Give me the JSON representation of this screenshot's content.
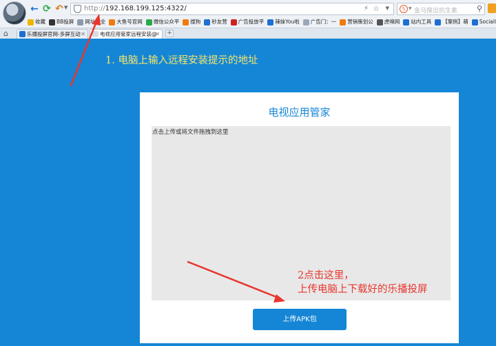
{
  "browser": {
    "address": {
      "url_prefix": "http://",
      "url_host": "192.168.199.125:4322/"
    },
    "search": {
      "placeholder": "金马搜出抗生素"
    },
    "bookmarks": [
      {
        "label": "收藏",
        "color": "#f0b400"
      },
      {
        "label": "BB投屏",
        "color": "#333333"
      },
      {
        "label": "网址大全",
        "color": "#8a9aab"
      },
      {
        "label": "大鱼号官网",
        "color": "#f07a10"
      },
      {
        "label": "微信公众平",
        "color": "#2aa84a"
      },
      {
        "label": "搜狗",
        "color": "#f07a10"
      },
      {
        "label": "秒友营",
        "color": "#1e6fd1"
      },
      {
        "label": "广告投放平",
        "color": "#d02020"
      },
      {
        "label": "辣妹You啦",
        "color": "#1e6fd1"
      },
      {
        "label": "广告门：一",
        "color": "#9aa8b8"
      },
      {
        "label": "营销策划公",
        "color": "#f07a10"
      },
      {
        "label": "虎嗅网",
        "color": "#555555"
      },
      {
        "label": "站内工具",
        "color": "#1e6fd1"
      },
      {
        "label": "【案例】萌",
        "color": "#1e6fd1"
      },
      {
        "label": "Socialli",
        "color": "#1e6fd1"
      }
    ],
    "tabs": [
      {
        "label": "乐播投屏官网-多屏互动"
      },
      {
        "label": "电视应用管家远程安装@"
      }
    ]
  },
  "annotations": {
    "step1": "1. 电脑上输入远程安装提示的地址",
    "step2_line1": "2点击这里，",
    "step2_line2": "上传电脑上下载好的乐播投屏"
  },
  "card": {
    "title": "电视应用管家",
    "dropzone_hint": "点击上传或将文件拖拽到这里",
    "upload_button": "上传APK包"
  },
  "colors": {
    "page_background": "#1586d6",
    "accent": "#1586d6",
    "annotation_yellow": "#f4e66a",
    "annotation_red": "#e8352d"
  }
}
